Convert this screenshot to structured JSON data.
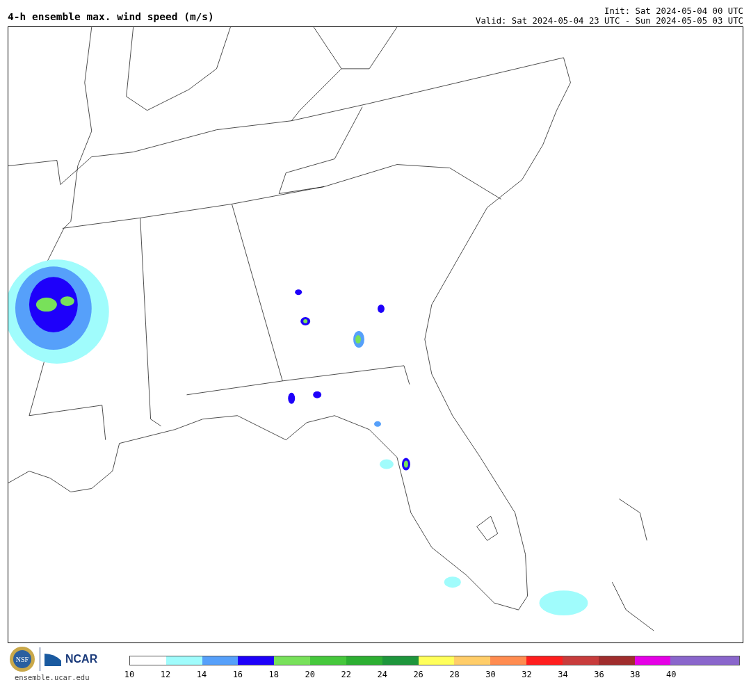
{
  "title": "4-h ensemble max. wind speed (m/s)",
  "init": "Init: Sat 2024-05-04 00 UTC",
  "valid": "Valid: Sat 2024-05-04 23 UTC - Sun 2024-05-05 03 UTC",
  "logos": {
    "nsf": "NSF",
    "ncar": "NCAR",
    "site": "ensemble.ucar.edu"
  },
  "colorbar": [
    {
      "label": "10",
      "color": "#ffffff"
    },
    {
      "label": "12",
      "color": "#a0fcfc"
    },
    {
      "label": "14",
      "color": "#56a0fa"
    },
    {
      "label": "16",
      "color": "#1e00fa"
    },
    {
      "label": "18",
      "color": "#78e15a"
    },
    {
      "label": "20",
      "color": "#46c83c"
    },
    {
      "label": "22",
      "color": "#2daf32"
    },
    {
      "label": "24",
      "color": "#1e963c"
    },
    {
      "label": "26",
      "color": "#ffff5a"
    },
    {
      "label": "28",
      "color": "#ffcd69"
    },
    {
      "label": "30",
      "color": "#ff8c50"
    },
    {
      "label": "32",
      "color": "#ff1e1e"
    },
    {
      "label": "34",
      "color": "#c83c3c"
    },
    {
      "label": "36",
      "color": "#a02d2d"
    },
    {
      "label": "38",
      "color": "#e600e6"
    },
    {
      "label": "40",
      "color": "#8a66cc"
    },
    {
      "color": "#8a66cc"
    }
  ]
}
